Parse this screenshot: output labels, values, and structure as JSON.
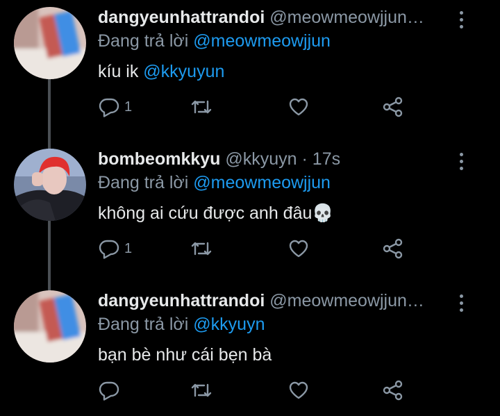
{
  "tweets": [
    {
      "name": "dangyeunhattrandoi",
      "handle": "@meowmeowjjun…",
      "time": "",
      "reply_prefix": "Đang trả lời",
      "reply_to": "@meowmeowjjun",
      "text": "kíu ik ",
      "text_mention": "@kkyuyun",
      "reply_count": "1",
      "avatar": "pink-red-blue-blur-avatar"
    },
    {
      "name": "bombeomkkyu",
      "handle": "@kkyuyn",
      "time": " · 17s",
      "reply_prefix": "Đang trả lời",
      "reply_to": "@meowmeowjjun",
      "text": "không ai cứu được anh đâu",
      "text_emoji": "💀",
      "reply_count": "1",
      "avatar": "red-haired-person-avatar"
    },
    {
      "name": "dangyeunhattrandoi",
      "handle": "@meowmeowjjun…",
      "time": "",
      "reply_prefix": "Đang trả lời",
      "reply_to": "@kkyuyn",
      "text": "bạn bè như cái bẹn bà",
      "reply_count": "",
      "avatar": "pink-red-blue-blur-avatar"
    }
  ],
  "icons": {
    "reply": "reply-icon",
    "retweet": "retweet-icon",
    "like": "heart-icon",
    "share": "share-icon",
    "more": "more-vertical-icon"
  },
  "colors": {
    "background": "#000000",
    "text": "#e7e9ea",
    "muted": "#8b98a5",
    "link": "#1d9bf0",
    "thread_line": "#4a4f54"
  }
}
